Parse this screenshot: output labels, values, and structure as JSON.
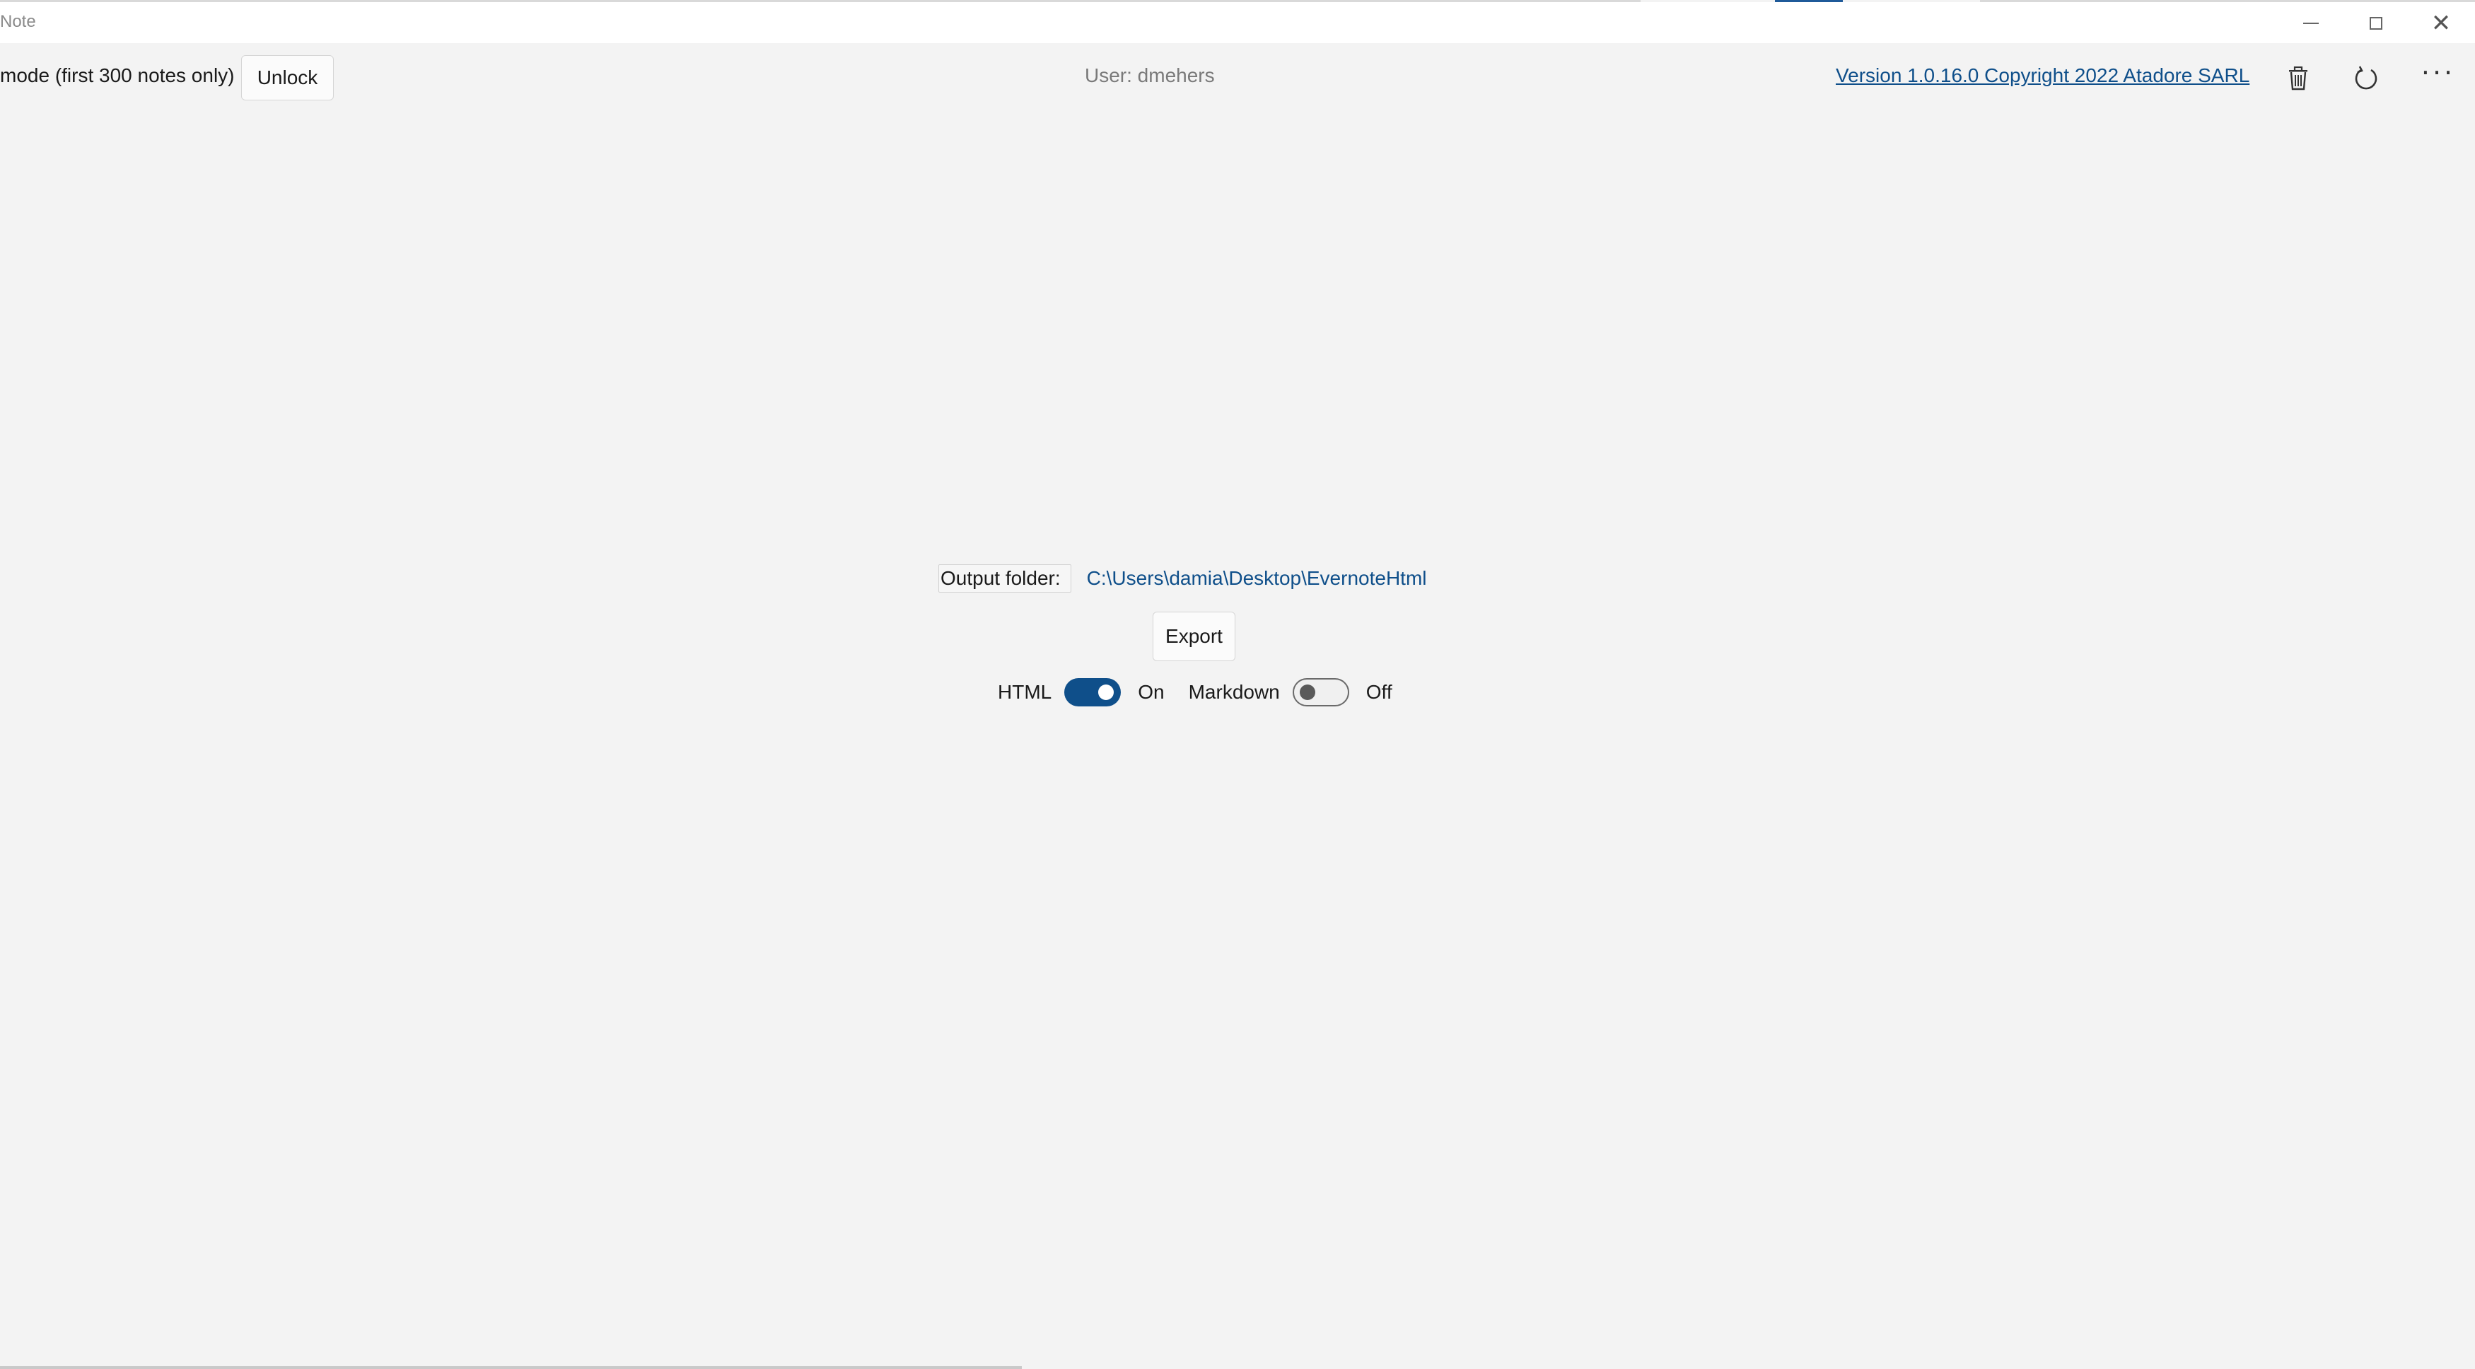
{
  "window": {
    "title": "Note",
    "controls": {
      "minimize": "minimize-icon",
      "maximize": "maximize-icon",
      "close": "close-icon"
    }
  },
  "toolbar": {
    "trial_text": "mode (first 300 notes only)",
    "unlock_label": "Unlock",
    "user_text": "User: dmehers",
    "version_text": "Version 1.0.16.0  Copyright 2022 Atadore SARL",
    "icons": [
      "trash-icon",
      "refresh-icon",
      "more-icon"
    ]
  },
  "main": {
    "output_label": "Output folder:",
    "output_path": "C:\\Users\\damia\\Desktop\\EvernoteHtml",
    "export_label": "Export",
    "toggles": [
      {
        "label": "HTML",
        "state": "On",
        "on": true
      },
      {
        "label": "Markdown",
        "state": "Off",
        "on": false
      }
    ]
  },
  "colors": {
    "accent": "#0f4f8a",
    "background": "#f3f3f3"
  }
}
